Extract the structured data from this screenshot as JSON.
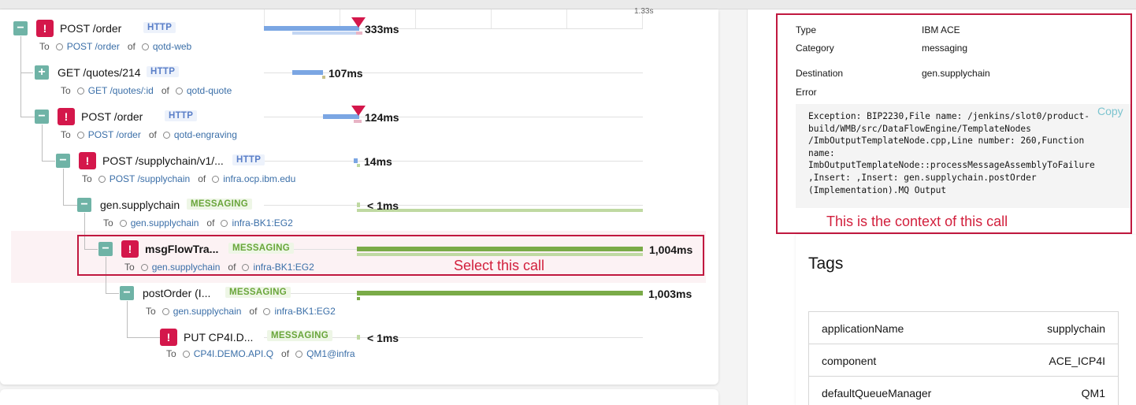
{
  "timeline": {
    "tick_label": "1.33s"
  },
  "spans": [
    {
      "toggle": "−",
      "error": true,
      "name": "POST /order",
      "tag": "HTTP",
      "to_label": "To",
      "endpoint": "POST /order",
      "of": "of",
      "service": "qotd-web",
      "duration": "333ms"
    },
    {
      "toggle": "+",
      "error": false,
      "name": "GET /quotes/214",
      "tag": "HTTP",
      "to_label": "To",
      "endpoint": "GET /quotes/:id",
      "of": "of",
      "service": "qotd-quote",
      "duration": "107ms"
    },
    {
      "toggle": "−",
      "error": true,
      "name": "POST /order",
      "tag": "HTTP",
      "to_label": "To",
      "endpoint": "POST /order",
      "of": "of",
      "service": "qotd-engraving",
      "duration": "124ms"
    },
    {
      "toggle": "−",
      "error": true,
      "name": "POST /supplychain/v1/...",
      "tag": "HTTP",
      "to_label": "To",
      "endpoint": "POST /supplychain",
      "of": "of",
      "service": "infra.ocp.ibm.edu",
      "duration": "14ms"
    },
    {
      "toggle": "−",
      "error": false,
      "name": "gen.supplychain",
      "tag": "MESSAGING",
      "to_label": "To",
      "endpoint": "gen.supplychain",
      "of": "of",
      "service": "infra-BK1:EG2",
      "duration": "< 1ms"
    },
    {
      "toggle": "−",
      "error": true,
      "name": "msgFlowTra...",
      "tag": "MESSAGING",
      "to_label": "To",
      "endpoint": "gen.supplychain",
      "of": "of",
      "service": "infra-BK1:EG2",
      "duration": "1,004ms"
    },
    {
      "toggle": "−",
      "error": false,
      "name": "postOrder (I...",
      "tag": "MESSAGING",
      "to_label": "To",
      "endpoint": "gen.supplychain",
      "of": "of",
      "service": "infra-BK1:EG2",
      "duration": "1,003ms"
    },
    {
      "toggle": "",
      "error": true,
      "name": "PUT CP4I.D...",
      "tag": "MESSAGING",
      "to_label": "To",
      "endpoint": "CP4I.DEMO.API.Q",
      "of": "of",
      "service": "QM1@infra",
      "duration": "< 1ms"
    }
  ],
  "error_mark": "!",
  "annotations": {
    "select": "Select this call",
    "context": "This is the context of this call"
  },
  "details": {
    "type_label": "Type",
    "type_value": "IBM ACE",
    "category_label": "Category",
    "category_value": "messaging",
    "destination_label": "Destination",
    "destination_value": "gen.supplychain",
    "error_label": "Error",
    "error_text": "Exception: BIP2230,File name: /jenkins/slot0/product-\nbuild/WMB/src/DataFlowEngine/TemplateNodes\n/ImbOutputTemplateNode.cpp,Line number: 260,Function\nname:\nImbOutputTemplateNode::processMessageAssemblyToFailure\n,Insert: ,Insert: gen.supplychain.postOrder\n(Implementation).MQ Output",
    "copy_label": "Copy"
  },
  "tags": {
    "title": "Tags",
    "rows": [
      {
        "key": "applicationName",
        "value": "supplychain"
      },
      {
        "key": "component",
        "value": "ACE_ICP4I"
      },
      {
        "key": "defaultQueueManager",
        "value": "QM1"
      }
    ]
  },
  "colors": {
    "http_bar": "#7ba6e3",
    "http_bar_light": "#c3d6f3",
    "msg_bar": "#7aab48",
    "msg_bar_light": "#bfd9a2",
    "error": "#d4174b",
    "toggle": "#6fb3a6",
    "annotation": "#c0183f"
  }
}
